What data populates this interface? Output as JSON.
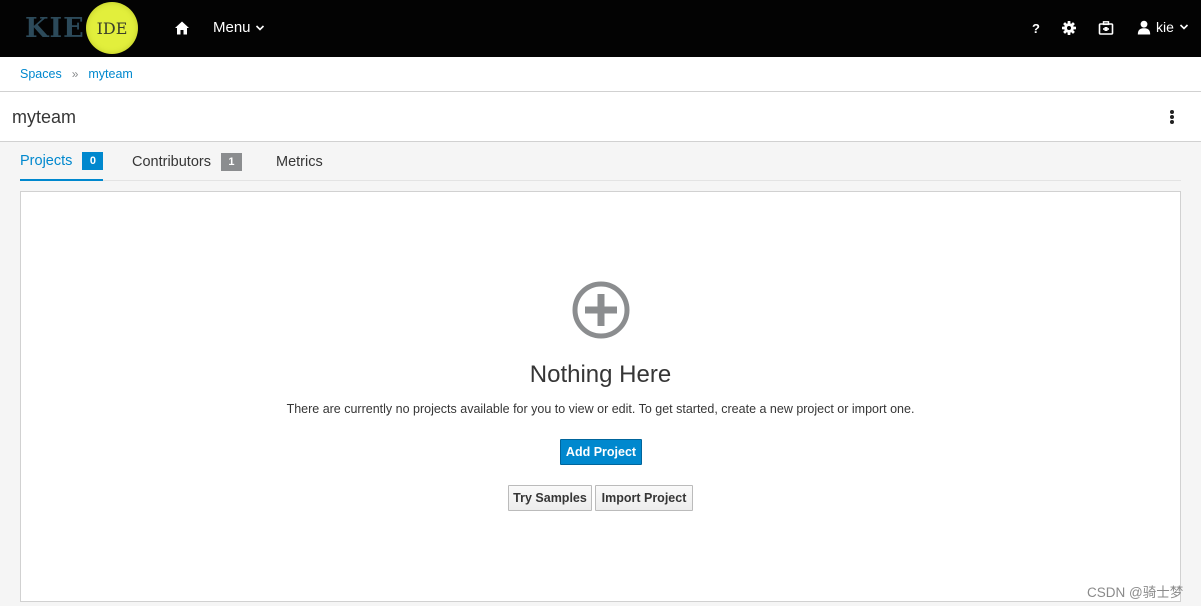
{
  "navbar": {
    "logo_primary": "KIE",
    "logo_secondary": "IDE",
    "menu_label": "Menu",
    "user_name": "kie",
    "icons": [
      "home-icon",
      "help-icon",
      "gear-icon",
      "briefcase-icon",
      "user-icon"
    ]
  },
  "breadcrumb": {
    "items": [
      "Spaces",
      "myteam"
    ],
    "separator": "»"
  },
  "page": {
    "title": "myteam"
  },
  "tabs": [
    {
      "label": "Projects",
      "count": "0",
      "active": true
    },
    {
      "label": "Contributors",
      "count": "1",
      "active": false
    },
    {
      "label": "Metrics",
      "count": null,
      "active": false
    }
  ],
  "empty_state": {
    "title": "Nothing Here",
    "message": "There are currently no projects available for you to view or edit. To get started, create a new project or import one.",
    "primary_button": "Add Project",
    "secondary_buttons": [
      "Try Samples",
      "Import Project"
    ]
  },
  "watermark": "CSDN @骑士梦",
  "colors": {
    "accent": "#0088ce",
    "navbar_bg": "#030303",
    "logo_circle": "#e2ef3c",
    "badge_grey": "#8b8d8f"
  }
}
